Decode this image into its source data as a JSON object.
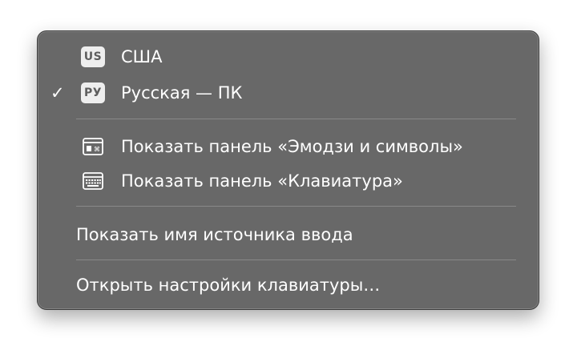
{
  "menu": {
    "layouts": [
      {
        "badge": "US",
        "label": "США",
        "checked": false
      },
      {
        "badge": "РУ",
        "label": "Русская — ПК",
        "checked": true,
        "check_mark": "✓"
      }
    ],
    "panels": [
      {
        "icon": "emoji-symbols-viewer-icon",
        "label": "Показать панель «Эмодзи и символы»"
      },
      {
        "icon": "keyboard-viewer-icon",
        "label": "Показать панель «Клавиатура»"
      }
    ],
    "show_input_source_name": "Показать имя источника ввода",
    "open_keyboard_settings": "Открыть настройки клавиатуры…"
  },
  "colors": {
    "menu_background": "#686868",
    "text": "#ffffff",
    "badge_background": "#eeeeee",
    "badge_text": "#5e5e5e",
    "separator": "#898989"
  }
}
